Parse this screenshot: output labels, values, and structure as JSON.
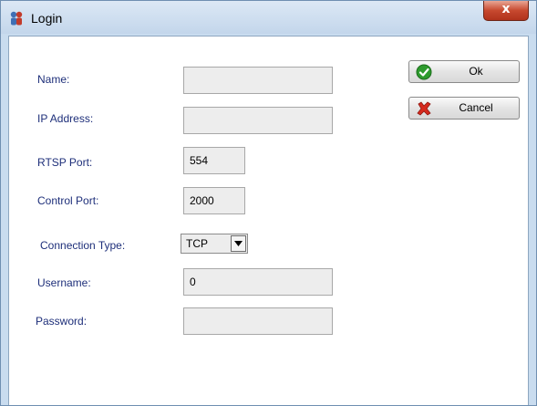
{
  "window": {
    "title": "Login",
    "close_glyph": "x",
    "app_icon": "app-icon"
  },
  "form": {
    "name": {
      "label": "Name:",
      "value": ""
    },
    "ip_address": {
      "label": "IP Address:",
      "value": ""
    },
    "rtsp_port": {
      "label": "RTSP Port:",
      "value": "554"
    },
    "control_port": {
      "label": "Control Port:",
      "value": "2000"
    },
    "connection_type": {
      "label": "Connection Type:",
      "selected": "TCP"
    },
    "username": {
      "label": "Username:",
      "value": "0"
    },
    "password": {
      "label": "Password:",
      "value": ""
    }
  },
  "buttons": {
    "ok": {
      "label": "Ok",
      "icon": "check-icon"
    },
    "cancel": {
      "label": "Cancel",
      "icon": "x-icon"
    }
  },
  "colors": {
    "label_text": "#1e2f7a",
    "close_button": "#c7492f",
    "ok_icon": "#2e9b2e",
    "cancel_icon": "#d62a1e"
  }
}
